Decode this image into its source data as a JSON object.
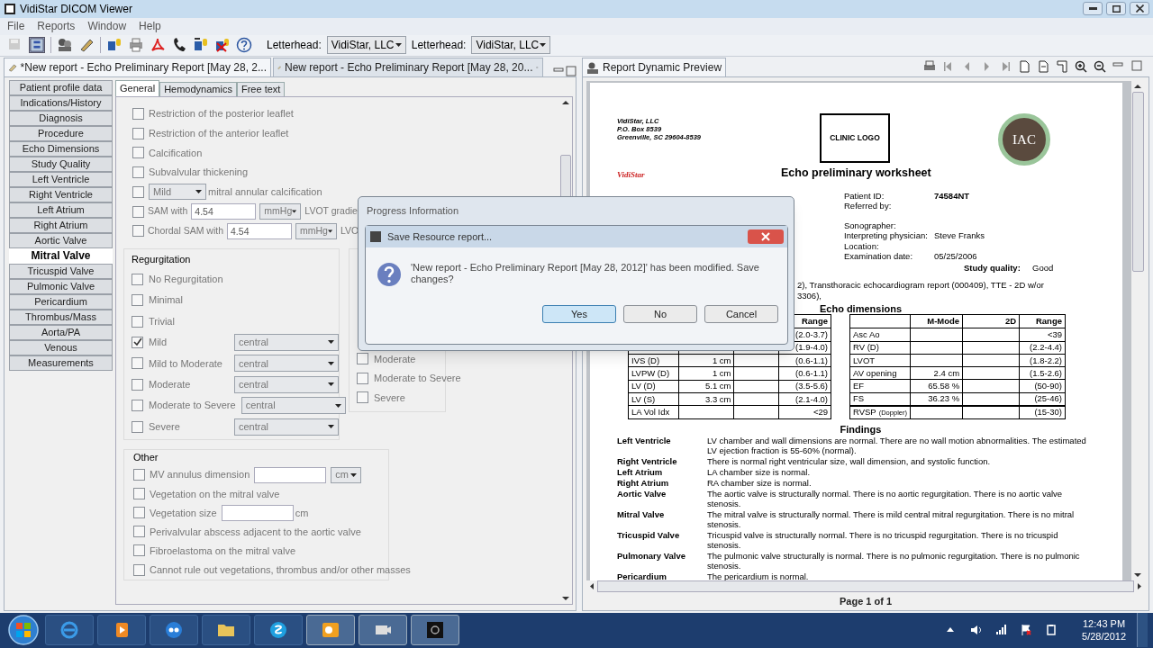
{
  "window": {
    "title": "VidiStar DICOM Viewer"
  },
  "menu": [
    "File",
    "Reports",
    "Window",
    "Help"
  ],
  "toolbar": {
    "letterheads": [
      {
        "label": "Letterhead:",
        "value": "VidiStar, LLC"
      },
      {
        "label": "Letterhead:",
        "value": "VidiStar, LLC"
      }
    ]
  },
  "editor_tabs": [
    {
      "label": "*New report - Echo Preliminary Report [May 28, 2...",
      "selected": true
    },
    {
      "label": "New report - Echo Preliminary Report [May 28, 20...",
      "selected": false
    }
  ],
  "sections": [
    {
      "label": "Patient profile data",
      "selected": false
    },
    {
      "label": "Indications/History",
      "selected": false
    },
    {
      "label": "Diagnosis",
      "selected": false
    },
    {
      "label": "Procedure",
      "selected": false
    },
    {
      "label": "Echo Dimensions",
      "selected": false
    },
    {
      "label": "Study Quality",
      "selected": false
    },
    {
      "label": "Left Ventricle",
      "selected": false
    },
    {
      "label": "Right Ventricle",
      "selected": false
    },
    {
      "label": "Left Atrium",
      "selected": false
    },
    {
      "label": "Right Atrium",
      "selected": false
    },
    {
      "label": "Aortic Valve",
      "selected": false
    },
    {
      "label": "Mitral Valve",
      "selected": true
    },
    {
      "label": "Tricuspid Valve",
      "selected": false
    },
    {
      "label": "Pulmonic Valve",
      "selected": false
    },
    {
      "label": "Pericardium",
      "selected": false
    },
    {
      "label": "Thrombus/Mass",
      "selected": false
    },
    {
      "label": "Aorta/PA",
      "selected": false
    },
    {
      "label": "Venous",
      "selected": false
    },
    {
      "label": "Measurements",
      "selected": false
    }
  ],
  "form_tabs": [
    {
      "label": "General",
      "selected": true
    },
    {
      "label": "Hemodynamics",
      "selected": false
    },
    {
      "label": "Free text",
      "selected": false
    }
  ],
  "general_rows": [
    {
      "kind": "check",
      "label": "Restriction of the posterior leaflet",
      "checked": false
    },
    {
      "kind": "check",
      "label": "Restriction of the anterior leaflet",
      "checked": false
    },
    {
      "kind": "check",
      "label": "Calcification",
      "checked": false
    },
    {
      "kind": "check",
      "label": "Subvalvular thickening",
      "checked": false
    },
    {
      "kind": "select_check",
      "select": "Mild",
      "label": "mitral annular calcification",
      "checked": false
    },
    {
      "kind": "value_check",
      "label": "SAM with",
      "value": "4.54",
      "unit": "mmHg",
      "trailing": "LVOT gradie",
      "checked": false
    },
    {
      "kind": "value_check",
      "label": "Chordal SAM with",
      "value": "4.54",
      "unit": "mmHg",
      "trailing": "LVO",
      "checked": false
    }
  ],
  "regurgitation": {
    "title": "Regurgitation",
    "items": [
      {
        "label": "No Regurgitation",
        "checked": false
      },
      {
        "label": "Minimal",
        "checked": false
      },
      {
        "label": "Trivial",
        "checked": false
      },
      {
        "label": "Mild",
        "checked": true,
        "select": "central"
      },
      {
        "label": "Mild to Moderate",
        "checked": false,
        "select": "central"
      },
      {
        "label": "Moderate",
        "checked": false,
        "select": "central"
      },
      {
        "label": "Moderate to Severe",
        "checked": false,
        "select": "central"
      },
      {
        "label": "Severe",
        "checked": false,
        "select": "central"
      }
    ]
  },
  "stenosis": {
    "items": [
      {
        "label": "Moderate",
        "checked": false
      },
      {
        "label": "Moderate to Severe",
        "checked": false
      },
      {
        "label": "Severe",
        "checked": false
      }
    ]
  },
  "other": {
    "title": "Other",
    "items": [
      {
        "kind": "input_select",
        "label": "MV annulus dimension",
        "unit": "cm",
        "checked": false
      },
      {
        "kind": "check",
        "label": "Vegetation on the mitral valve",
        "checked": false
      },
      {
        "kind": "input_unit",
        "label": "Vegetation size",
        "unit": "cm",
        "checked": false
      },
      {
        "kind": "check",
        "label": "Perivalvular abscess adjacent to the aortic valve",
        "checked": false
      },
      {
        "kind": "check",
        "label": "Fibroelastoma on the mitral valve",
        "checked": false
      },
      {
        "kind": "check",
        "label": "Cannot rule out vegetations, thrombus  and/or other masses",
        "checked": false
      }
    ]
  },
  "preview": {
    "title": "Report Dynamic Preview",
    "page_status": "Page 1 of 1",
    "report": {
      "address": [
        "VidiStar, LLC",
        "P.O. Box 8539",
        "Greenville, SC 29604-8539"
      ],
      "logo_text": "CLINIC LOGO",
      "seal_text": "IAC",
      "brand": "VidiStar",
      "title": "Echo preliminary worksheet",
      "patient_info": [
        {
          "label": "Patient ID:",
          "value": "74584NT"
        },
        {
          "label": "Referred by:"
        }
      ],
      "exam_info": [
        {
          "label": "Sonographer:"
        },
        {
          "label": "Interpreting physician:",
          "value": "Steve Franks"
        },
        {
          "label": "Location:"
        },
        {
          "label": "Examination date:",
          "value": "05/25/2006"
        }
      ],
      "study_quality": {
        "label": "Study quality:",
        "value": "Good"
      },
      "diagnosis_lines": [
        "2), Transthoracic echocardiogram report (000409), TTE - 2D w/or",
        "3306),"
      ],
      "dimensions_title": "Echo dimensions",
      "left_table": {
        "header": {
          "range": "Range"
        },
        "rows": [
          [
            null,
            null,
            null,
            "(2.0-3.7)"
          ],
          [
            null,
            null,
            null,
            "(1.9-4.0)"
          ],
          [
            "IVS (D)",
            "1 cm",
            null,
            "(0.6-1.1)"
          ],
          [
            "LVPW (D)",
            "1 cm",
            null,
            "(0.6-1.1)"
          ],
          [
            "LV (D)",
            "5.1 cm",
            null,
            "(3.5-5.6)"
          ],
          [
            "LV (S)",
            "3.3 cm",
            null,
            "(2.1-4.0)"
          ],
          [
            "LA Vol Idx",
            null,
            null,
            "<29"
          ]
        ]
      },
      "right_table": {
        "header": {
          "m_mode": "M-Mode",
          "two_d": "2D",
          "range": "Range"
        },
        "rows": [
          {
            "cells": [
              "Asc Ao",
              null,
              null,
              "<39"
            ]
          },
          {
            "cells": [
              "RV (D)",
              null,
              null,
              "(2.2-4.4)"
            ]
          },
          {
            "cells": [
              "LVOT",
              null,
              null,
              "(1.8-2.2)"
            ]
          },
          {
            "cells": [
              "AV opening",
              "2.4 cm",
              null,
              "(1.5-2.6)"
            ]
          },
          {
            "cells": [
              "EF",
              "65.58 %",
              null,
              "(50-90)"
            ]
          },
          {
            "cells": [
              "FS",
              "36.23 %",
              null,
              "(25-46)"
            ]
          },
          {
            "cells": [
              "RVSP",
              null,
              null,
              "(15-30)"
            ],
            "note": "(Doppler)"
          }
        ]
      },
      "findings_title": "Findings",
      "findings": [
        {
          "label": "Left Ventricle",
          "text": "LV chamber and wall dimensions are normal. There are no wall motion abnormalities. The estimated LV ejection fraction is 55-60% (normal)."
        },
        {
          "label": "Right Ventricle",
          "text": "There is normal right ventricular size, wall dimension, and systolic function."
        },
        {
          "label": "Left Atrium",
          "text": "LA chamber size is normal."
        },
        {
          "label": "Right Atrium",
          "text": "RA chamber size is normal."
        },
        {
          "label": "Aortic Valve",
          "text": "The aortic valve is structurally normal. There is no aortic regurgitation. There is no aortic valve stenosis."
        },
        {
          "label": "Mitral Valve",
          "text": "The mitral valve is structurally normal. There is mild central mitral regurgitation. There is no mitral stenosis."
        },
        {
          "label": "Tricuspid Valve",
          "text": "Tricuspid valve is structurally normal. There is no tricuspid regurgitation. There is no tricuspid stenosis."
        },
        {
          "label": "Pulmonary Valve",
          "text": "The pulmonic valve structurally is normal. There is no pulmonic regurgitation. There is no pulmonic stenosis."
        },
        {
          "label": "Pericardium",
          "text": "The pericardium is normal."
        }
      ]
    }
  },
  "progress_window": {
    "title": "Progress Information"
  },
  "save_dialog": {
    "title": "Save Resource report...",
    "message": "'New report - Echo Preliminary Report [May 28, 2012]' has been modified. Save changes?",
    "buttons": [
      {
        "label": "Yes",
        "selected": true
      },
      {
        "label": "No",
        "selected": false
      },
      {
        "label": "Cancel",
        "selected": false
      }
    ]
  },
  "taskbar": {
    "time": "12:43 PM",
    "date": "5/28/2012"
  }
}
